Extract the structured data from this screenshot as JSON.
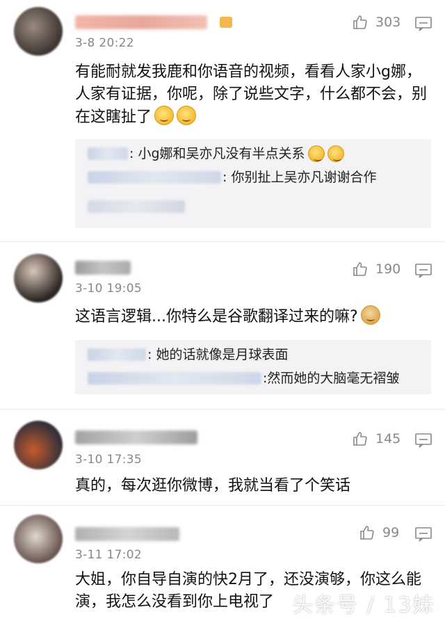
{
  "comments": [
    {
      "timestamp": "3-8 20:22",
      "likes": "303",
      "text": "有能耐就发我鹿和你语音的视频，看看人家小g娜，人家有证据，你呢，除了说些文字，什么都不会，别在这瞎扯了",
      "replies": [
        {
          "text": ": 小g娜和吴亦凡没有半点关系"
        },
        {
          "text": ": 你别扯上吴亦凡谢谢合作"
        }
      ]
    },
    {
      "timestamp": "3-10 19:05",
      "likes": "190",
      "text": "这语言逻辑...你特么是谷歌翻译过来的嘛?",
      "replies": [
        {
          "text": ": 她的话就像是月球表面"
        },
        {
          "text": ":然而她的大脑毫无褶皱"
        }
      ]
    },
    {
      "timestamp": "3-10 17:35",
      "likes": "145",
      "text": "真的，每次逛你微博，我就当看了个笑话"
    },
    {
      "timestamp": "3-11 17:02",
      "likes": "99",
      "text": "大姐，你自导自演的快2月了，还没演够，你这么能演，我怎么没看到你上电视了"
    }
  ],
  "watermark": "头条号 / 13妹",
  "icons": {
    "like": "thumbs-up-icon",
    "reply": "comment-bubble-icon"
  },
  "colors": {
    "meta_gray": "#888888",
    "reply_bg": "#f3f3f5",
    "link_blue": "#c9d3e6"
  }
}
